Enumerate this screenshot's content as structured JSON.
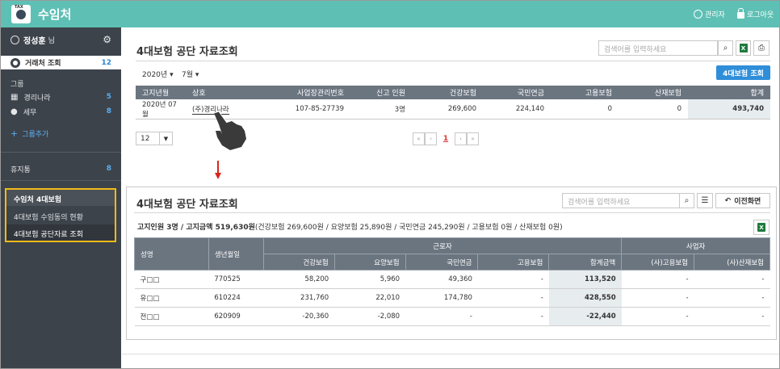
{
  "app": {
    "title": "수임처",
    "logo_text": "TAX",
    "admin_label": "관리자",
    "logout_label": "로그아웃"
  },
  "sidebar": {
    "user_name": "정성훈",
    "user_suffix": "님",
    "active_menu": {
      "label": "거래처 조회",
      "count": "12"
    },
    "group_header": "그룹",
    "groups": [
      {
        "label": "경리나라",
        "count": "5",
        "icon": "building-icon"
      },
      {
        "label": "세무",
        "count": "8",
        "icon": "person-icon"
      }
    ],
    "add_group_label": "그룹추가",
    "rest": {
      "label": "휴지통",
      "count": "8"
    },
    "submenu_header": "수임처 4대보험",
    "submenu": [
      {
        "label": "4대보험 수임동의 현황"
      },
      {
        "label": "4대보험 공단자료 조회"
      }
    ]
  },
  "panel1": {
    "title": "4대보험 공단 자료조회",
    "search_placeholder": "검색어를 입력하세요",
    "year": "2020년",
    "month": "7월",
    "query_button": "4대보험 조회",
    "columns": [
      "고지년월",
      "상호",
      "사업장관리번호",
      "신고 인원",
      "건강보험",
      "국민연금",
      "고용보험",
      "산재보험",
      "합계"
    ],
    "rows": [
      {
        "month": "2020년 07월",
        "company": "(주)경리나라",
        "biz_no": "107-85-27739",
        "persons": "3명",
        "health": "269,600",
        "pension": "224,140",
        "employment": "0",
        "industrial": "0",
        "total": "493,740"
      }
    ],
    "page_size": "12",
    "current_page": "1"
  },
  "panel2": {
    "title": "4대보험 공단 자료조회",
    "search_placeholder": "검색어를 입력하세요",
    "back_button": "이전화면",
    "summary_bold": "고지인원 3명 / 고지금액 519,630원",
    "summary_rest": "(건강보험 269,600원 / 요양보험 25,890원 / 국민연금 245,290원 / 고용보험 0원 / 산재보험 0원)",
    "header_top": {
      "name": "성명",
      "birth": "생년월일",
      "worker": "근로자",
      "employer": "사업자"
    },
    "header_sub": [
      "건강보험",
      "요양보험",
      "국민연금",
      "고용보험",
      "합계금액",
      "(사)고용보험",
      "(사)산재보험"
    ],
    "rows": [
      {
        "name": "구□□",
        "birth": "770525",
        "health": "58,200",
        "care": "5,960",
        "pension": "49,360",
        "employment": "-",
        "total": "113,520",
        "emp_employment": "-",
        "emp_industrial": "-"
      },
      {
        "name": "유□□",
        "birth": "610224",
        "health": "231,760",
        "care": "22,010",
        "pension": "174,780",
        "employment": "-",
        "total": "428,550",
        "emp_employment": "-",
        "emp_industrial": "-"
      },
      {
        "name": "전□□",
        "birth": "620909",
        "health": "-20,360",
        "care": "-2,080",
        "pension": "-",
        "employment": "-",
        "total": "-22,440",
        "emp_employment": "-",
        "emp_industrial": "-"
      }
    ]
  },
  "colors": {
    "topbar": "#5ec0b5",
    "sidebar": "#3d434b",
    "accent": "#2f8ed9",
    "highlight": "#f2bb1a",
    "table_header": "#6b7580"
  }
}
